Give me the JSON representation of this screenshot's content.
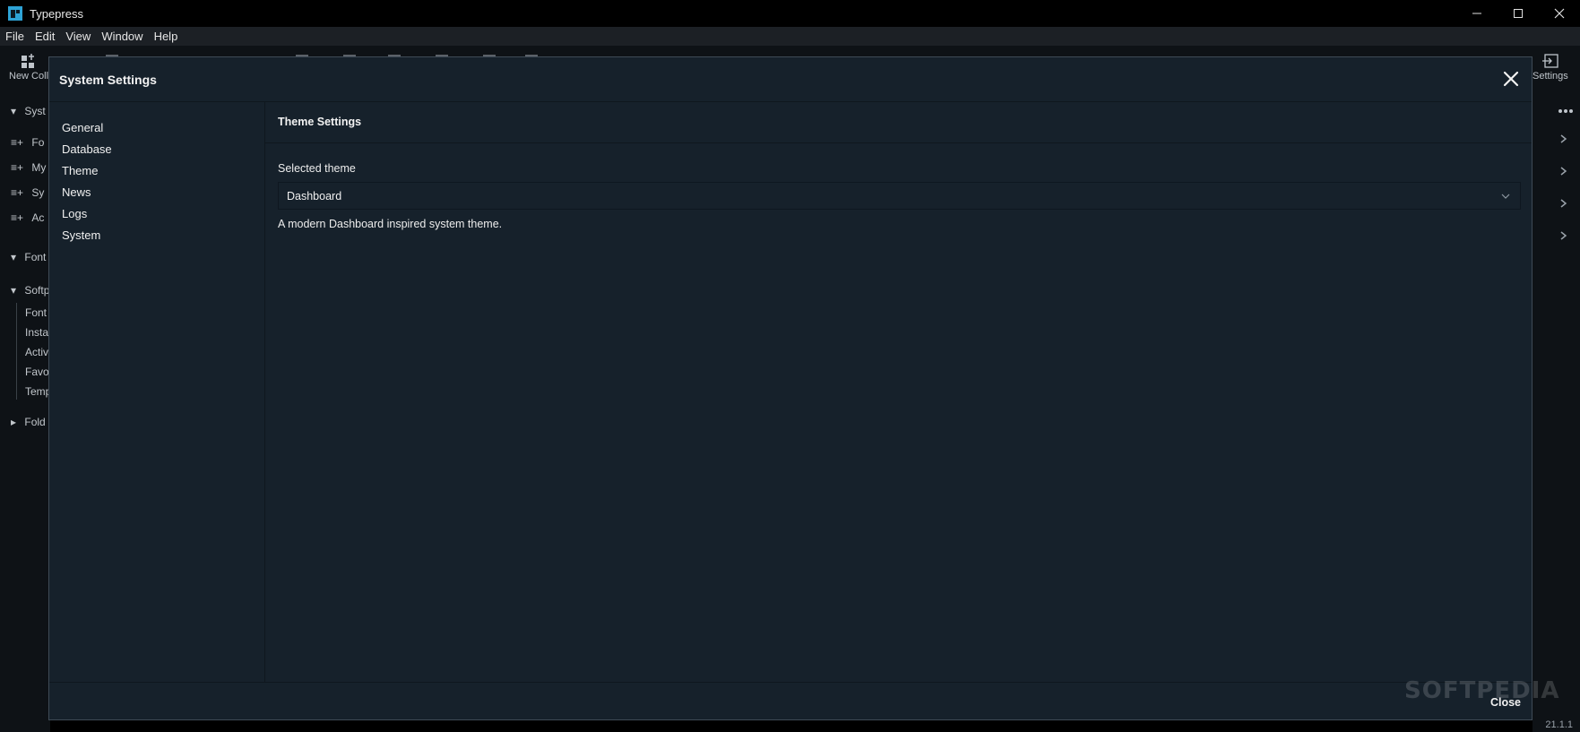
{
  "app": {
    "title": "Typepress",
    "accent": "#2ea3d6"
  },
  "menu": [
    "File",
    "Edit",
    "View",
    "Window",
    "Help"
  ],
  "toolbar": {
    "new_collection_label": "New Coll",
    "settings_label": "Settings"
  },
  "background_sidebar": {
    "items": [
      "Fo",
      "My",
      "Sy",
      "Ac"
    ],
    "sections": [
      "Syst",
      "Font",
      "Softp",
      "Fold"
    ],
    "tree": [
      "Font",
      "Insta",
      "Activ",
      "Favo",
      "Temp"
    ]
  },
  "status": {
    "version": "21.1.1"
  },
  "dialog": {
    "title": "System Settings",
    "nav": [
      "General",
      "Database",
      "Theme",
      "News",
      "Logs",
      "System"
    ],
    "section_title": "Theme Settings",
    "field_label": "Selected theme",
    "selected_value": "Dashboard",
    "description": "A modern Dashboard inspired system theme.",
    "close_label": "Close"
  },
  "watermark": "SOFTPEDIA"
}
